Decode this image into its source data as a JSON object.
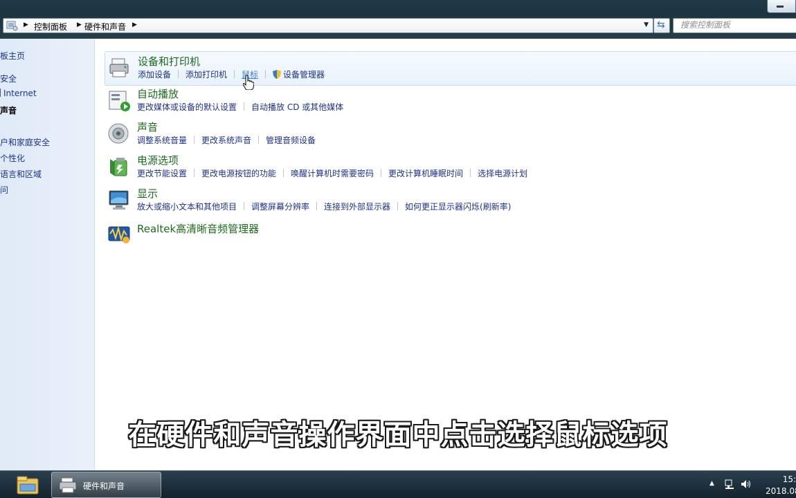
{
  "address": {
    "crumbs": [
      "控制面板",
      "硬件和声音"
    ]
  },
  "search": {
    "placeholder": "搜索控制面板"
  },
  "sidebar": {
    "items": [
      {
        "label": "板主页"
      },
      {
        "label": "安全"
      },
      {
        "label": "Internet"
      },
      {
        "label": "声音"
      },
      {
        "label": "户和家庭安全"
      },
      {
        "label": "个性化"
      },
      {
        "label": "语言和区域"
      },
      {
        "label": "问"
      }
    ]
  },
  "categories": [
    {
      "title": "设备和打印机",
      "icon": "printer-icon",
      "links": [
        "添加设备",
        "添加打印机",
        "鼠标",
        "设备管理器"
      ]
    },
    {
      "title": "自动播放",
      "icon": "autoplay-icon",
      "links": [
        "更改媒体或设备的默认设置",
        "自动播放 CD 或其他媒体"
      ]
    },
    {
      "title": "声音",
      "icon": "speaker-icon",
      "links": [
        "调整系统音量",
        "更改系统声音",
        "管理音频设备"
      ]
    },
    {
      "title": "电源选项",
      "icon": "battery-icon",
      "links": [
        "更改节能设置",
        "更改电源按钮的功能",
        "唤醒计算机时需要密码",
        "更改计算机睡眠时间",
        "选择电源计划"
      ]
    },
    {
      "title": "显示",
      "icon": "monitor-icon",
      "links": [
        "放大或缩小文本和其他项目",
        "调整屏幕分辨率",
        "连接到外部显示器",
        "如何更正显示器闪烁(刷新率)"
      ]
    },
    {
      "title": "Realtek高清晰音频管理器",
      "icon": "realtek-audio-icon",
      "links": []
    }
  ],
  "subtitle": "在硬件和声音操作界面中点击选择鼠标选项",
  "taskbar": {
    "task_label": "硬件和声音",
    "clock_time": "15:",
    "clock_date": "2018.08"
  },
  "colors": {
    "category_title": "#1e6b1e",
    "link": "#1e3287",
    "hover_link": "#3b7fd6",
    "sidebar_bg": "#dfeaf7"
  }
}
